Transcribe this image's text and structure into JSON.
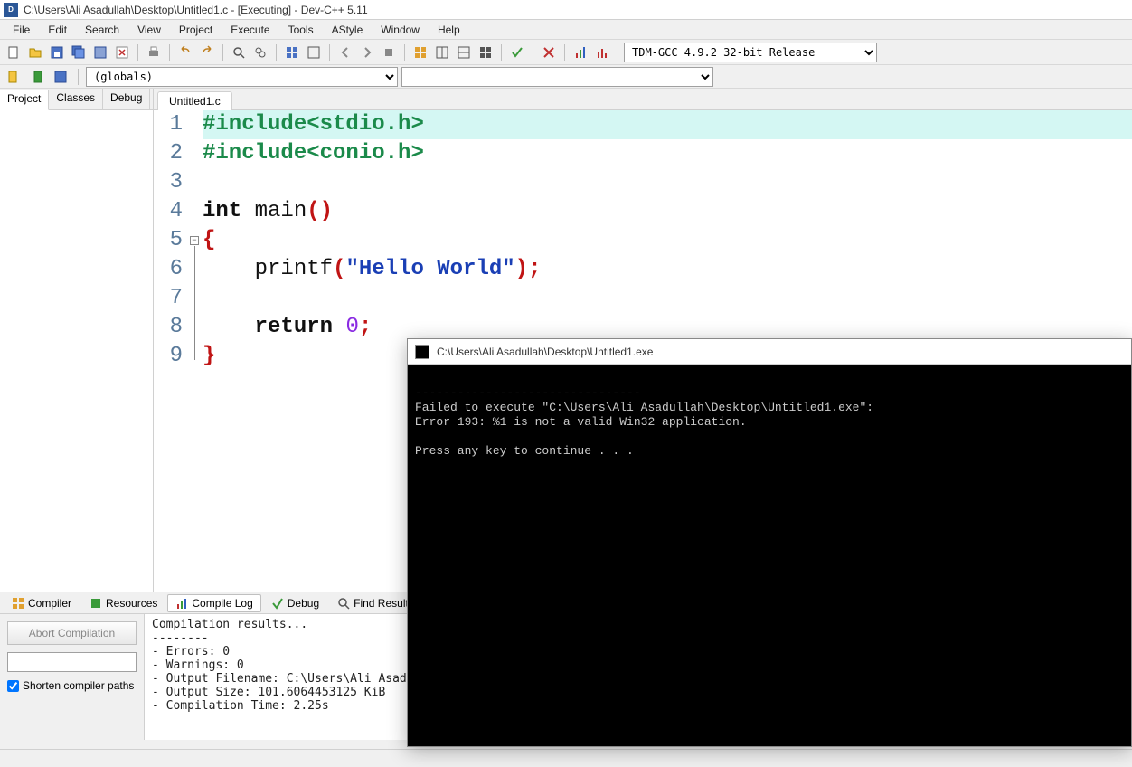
{
  "title": "C:\\Users\\Ali Asadullah\\Desktop\\Untitled1.c - [Executing] - Dev-C++ 5.11",
  "menu": [
    "File",
    "Edit",
    "Search",
    "View",
    "Project",
    "Execute",
    "Tools",
    "AStyle",
    "Window",
    "Help"
  ],
  "compiler_combo": "TDM-GCC 4.9.2 32-bit Release",
  "scope_combo": "(globals)",
  "side_tabs": [
    "Project",
    "Classes",
    "Debug"
  ],
  "file_tab": "Untitled1.c",
  "code": {
    "lines": [
      "1",
      "2",
      "3",
      "4",
      "5",
      "6",
      "7",
      "8",
      "9"
    ],
    "l1a": "#include",
    "l1b": "<stdio.h>",
    "l2a": "#include",
    "l2b": "<conio.h>",
    "l4a": "int",
    "l4b": " main",
    "l4c": "()",
    "l5": "{",
    "l6a": "    printf",
    "l6b": "(",
    "l6c": "\"Hello World\"",
    "l6d": ")",
    "l6e": ";",
    "l8a": "    return ",
    "l8b": "0",
    "l8c": ";",
    "l9": "}"
  },
  "bottom_tabs": [
    "Compiler",
    "Resources",
    "Compile Log",
    "Debug",
    "Find Results"
  ],
  "compile_controls": {
    "abort": "Abort Compilation",
    "shorten": "Shorten compiler paths"
  },
  "compile_output": "Compilation results...\n--------\n- Errors: 0\n- Warnings: 0\n- Output Filename: C:\\Users\\Ali Asad\n- Output Size: 101.6064453125 KiB\n- Compilation Time: 2.25s",
  "console": {
    "title": "C:\\Users\\Ali Asadullah\\Desktop\\Untitled1.exe",
    "body": "\n--------------------------------\nFailed to execute \"C:\\Users\\Ali Asadullah\\Desktop\\Untitled1.exe\":\nError 193: %1 is not a valid Win32 application.\n\nPress any key to continue . . ."
  },
  "status": {
    "line": "",
    "col": "",
    "sel": "",
    "lines_lbl": "",
    "len": ""
  }
}
